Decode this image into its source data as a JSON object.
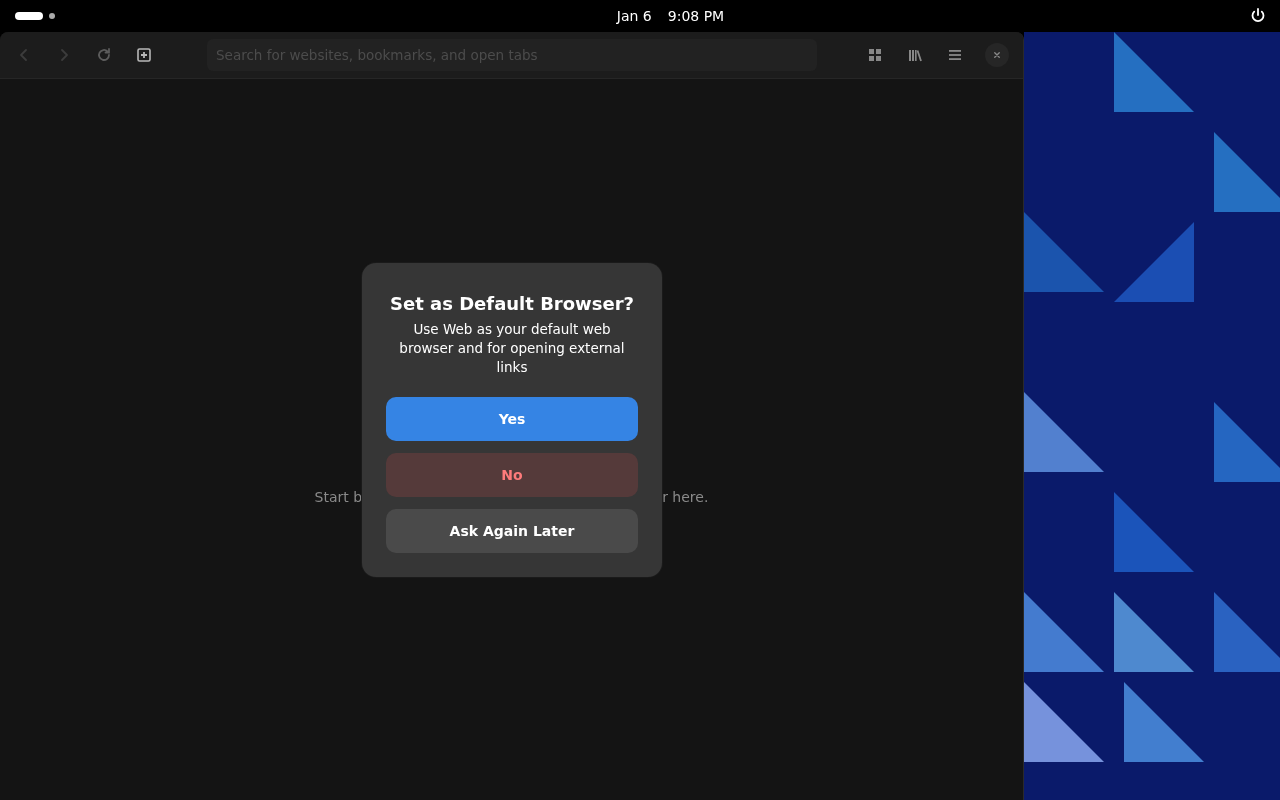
{
  "top_bar": {
    "date": "Jan 6",
    "time": "9:08 PM"
  },
  "browser": {
    "nav_buttons": [
      {
        "kind": "back",
        "disabled": true
      },
      {
        "kind": "forward",
        "disabled": true
      },
      {
        "kind": "reload",
        "disabled": false
      },
      {
        "kind": "new-tab",
        "disabled": false
      }
    ],
    "search": {
      "placeholder": "Search for websites, bookmarks, and open tabs"
    },
    "actions": [
      {
        "kind": "overview"
      },
      {
        "kind": "library"
      },
      {
        "kind": "menu"
      },
      {
        "kind": "close"
      }
    ],
    "empty_text": [
      "Start b",
      "r here."
    ]
  },
  "dialog": {
    "title": "Set as Default Browser?",
    "message": "Use Web as your default web browser and for opening external links",
    "buttons": [
      {
        "label": "Yes",
        "kind": "suggested"
      },
      {
        "label": "No",
        "kind": "destructive"
      },
      {
        "label": "Ask Again Later",
        "kind": "default"
      }
    ]
  }
}
